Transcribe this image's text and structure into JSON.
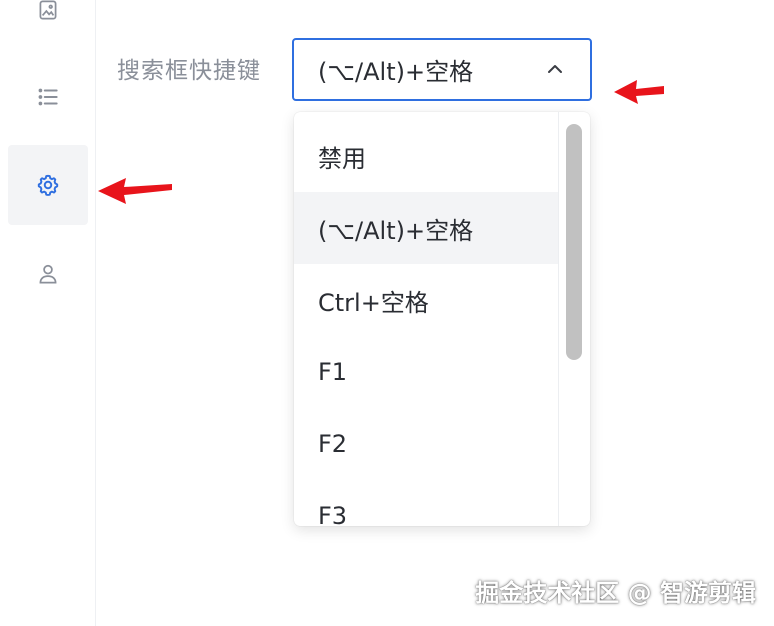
{
  "sidebar": {
    "items": [
      {
        "icon": "image-icon"
      },
      {
        "icon": "list-icon"
      },
      {
        "icon": "gear-icon",
        "active": true
      },
      {
        "icon": "user-icon"
      }
    ],
    "accent_color": "#2f6fe0"
  },
  "setting": {
    "label": "搜索框快捷键",
    "select": {
      "value": "(⌥/Alt)+空格",
      "expanded": true
    }
  },
  "dropdown": {
    "options": [
      {
        "label": "禁用"
      },
      {
        "label": "(⌥/Alt)+空格",
        "selected": true
      },
      {
        "label": "Ctrl+空格"
      },
      {
        "label": "F1"
      },
      {
        "label": "F2"
      },
      {
        "label": "F3"
      }
    ]
  },
  "annotation_color": "#e8141b",
  "watermark": "掘金技术社区 @ 智游剪辑"
}
